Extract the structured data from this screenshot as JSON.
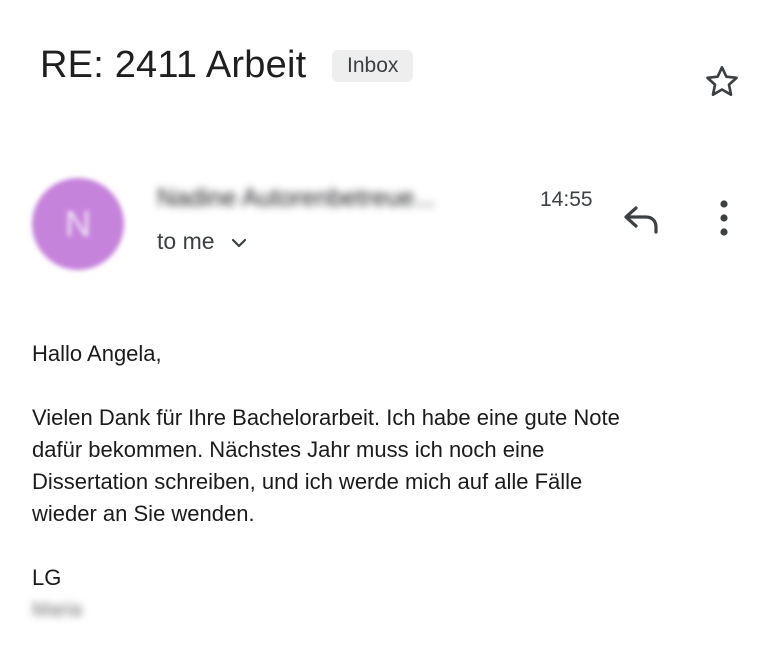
{
  "email": {
    "subject": "RE: 2411 Arbeit",
    "label": "Inbox",
    "sender": {
      "initial": "N",
      "name": "Nadine Autorenbetreue...",
      "time": "14:55",
      "recipient": "to me"
    },
    "body": {
      "greeting": "Hallo Angela,",
      "lines": [
        "Vielen Dank für Ihre Bachelorarbeit. Ich habe eine gute Note",
        "dafür bekommen. Nächstes Jahr muss ich noch eine",
        "Dissertation schreiben, und ich werde mich auf alle Fälle",
        "wieder an Sie wenden."
      ],
      "signoff": "LG",
      "signature": "Maria"
    }
  },
  "icons": {
    "star": "star-icon",
    "reply": "reply-icon",
    "more": "more-vert-icon",
    "chevron": "chevron-down-icon"
  },
  "colors": {
    "avatar": "#c683db",
    "badge_bg": "#eeeeee",
    "text": "#1f1f1f"
  }
}
